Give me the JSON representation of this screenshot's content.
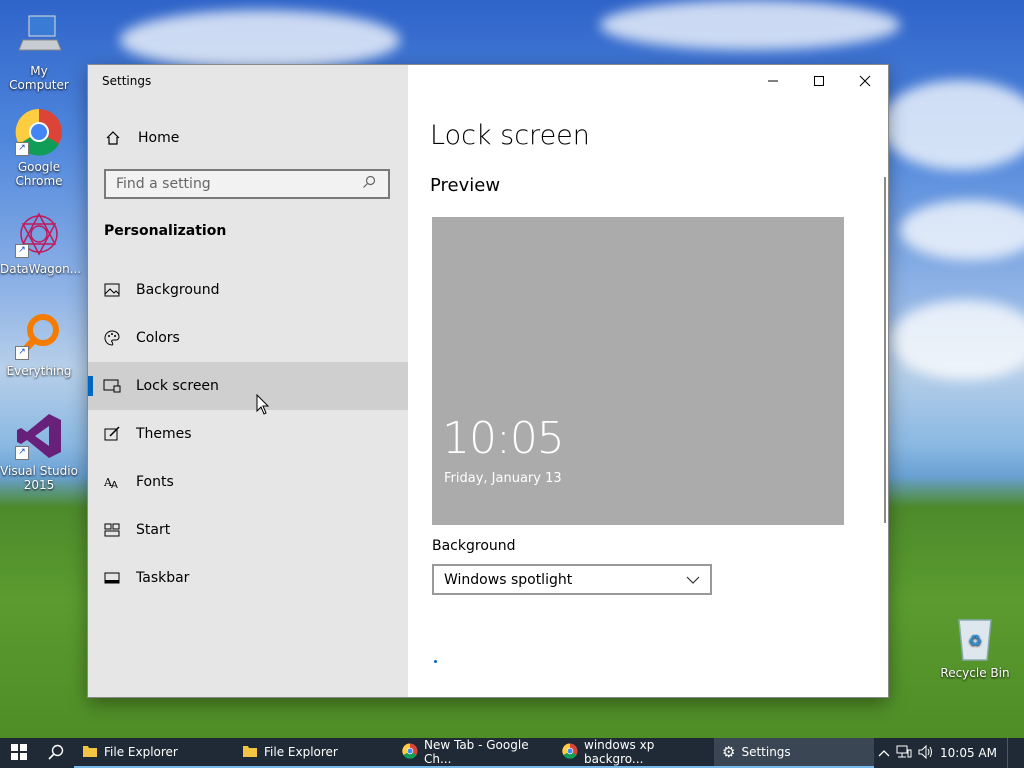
{
  "desktop": {
    "icons": [
      {
        "label": "My Computer"
      },
      {
        "label": "Google Chrome"
      },
      {
        "label": "DataWagon..."
      },
      {
        "label": "Everything"
      },
      {
        "label": "Visual Studio 2015"
      },
      {
        "label": "Recycle Bin"
      }
    ]
  },
  "window": {
    "title": "Settings",
    "controls": {
      "minimize": "–",
      "maximize": "☐",
      "close": "✕"
    }
  },
  "sidebar": {
    "home_label": "Home",
    "search_placeholder": "Find a setting",
    "section_title": "Personalization",
    "items": [
      {
        "label": "Background",
        "icon": "image-icon"
      },
      {
        "label": "Colors",
        "icon": "palette-icon"
      },
      {
        "label": "Lock screen",
        "icon": "lock-screen-icon",
        "selected": true
      },
      {
        "label": "Themes",
        "icon": "themes-icon"
      },
      {
        "label": "Fonts",
        "icon": "fonts-icon"
      },
      {
        "label": "Start",
        "icon": "start-icon"
      },
      {
        "label": "Taskbar",
        "icon": "taskbar-icon"
      }
    ]
  },
  "main": {
    "page_title": "Lock screen",
    "preview_heading": "Preview",
    "preview_time": "10:05",
    "preview_date": "Friday, January 13",
    "background_label": "Background",
    "background_value": "Windows spotlight"
  },
  "taskbar": {
    "apps": [
      {
        "label": "File Explorer",
        "icon": "folder-icon"
      },
      {
        "label": "File Explorer",
        "icon": "folder-icon"
      },
      {
        "label": "New Tab - Google Ch...",
        "icon": "chrome-icon"
      },
      {
        "label": "windows xp backgro...",
        "icon": "chrome-icon"
      },
      {
        "label": "Settings",
        "icon": "gear-icon"
      }
    ],
    "clock": "10:05 AM"
  },
  "colors": {
    "accent": "#0067c0",
    "sidebar_bg": "#e6e6e6",
    "selected_bg": "#cfcfcf",
    "taskbar_bg": "#1f2a36"
  }
}
